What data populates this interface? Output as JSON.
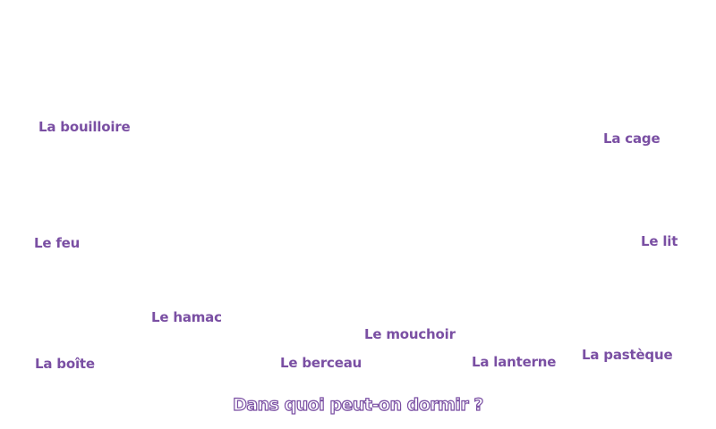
{
  "question": "Dans quoi peut-on dormir ?",
  "words": {
    "bouilloire": "La bouilloire",
    "cage": "La cage",
    "feu": "Le feu",
    "lit": "Le lit",
    "hamac": "Le hamac",
    "mouchoir": "Le mouchoir",
    "boite": "La boîte",
    "berceau": "Le berceau",
    "lanterne": "La lanterne",
    "pasteque": "La pastèque"
  },
  "colors": {
    "word": "#7a4fa3",
    "background": "#ffffff"
  }
}
